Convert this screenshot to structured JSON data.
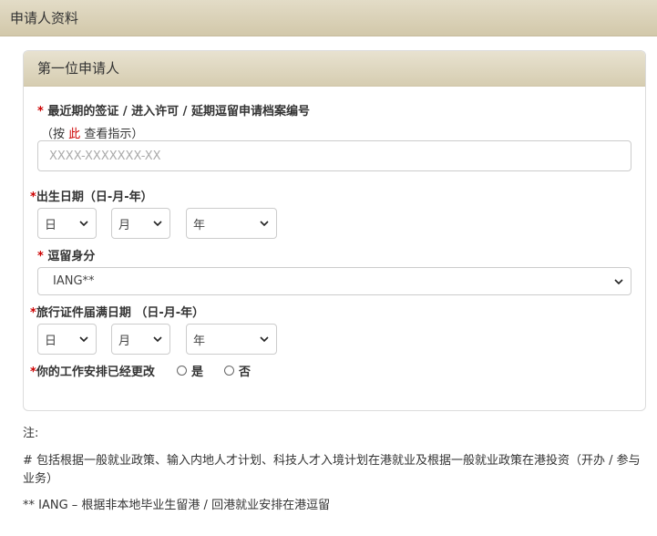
{
  "page": {
    "header_title": "申请人资料"
  },
  "card": {
    "title": "第一位申请人",
    "fields": {
      "visa_number": {
        "required_mark": "*",
        "label": "最近期的签证 / 进入许可 / 延期逗留申请档案编号",
        "hint_prefix": "（按",
        "hint_link": "此",
        "hint_suffix": "查看指示）",
        "placeholder": "XXXX-XXXXXXX-XX",
        "value": ""
      },
      "dob": {
        "required_mark": "*",
        "label": "出生日期（日-月-年）",
        "day": "日",
        "month": "月",
        "year": "年"
      },
      "stay_status": {
        "required_mark": "*",
        "label": "逗留身分",
        "selected": "IANG**"
      },
      "doc_expiry": {
        "required_mark": "*",
        "label": "旅行证件届满日期 （日-月-年）",
        "day": "日",
        "month": "月",
        "year": "年"
      },
      "work_change": {
        "required_mark": "*",
        "label": "你的工作安排已经更改",
        "yes": "是",
        "no": "否"
      }
    }
  },
  "notes": {
    "heading": "注:",
    "line1": "# 包括根据一般就业政策、输入内地人才计划、科技人才入境计划在港就业及根据一般就业政策在港投资（开办 / 参与业务）",
    "line2": "** IANG – 根据非本地毕业生留港 / 回港就业安排在港逗留"
  }
}
